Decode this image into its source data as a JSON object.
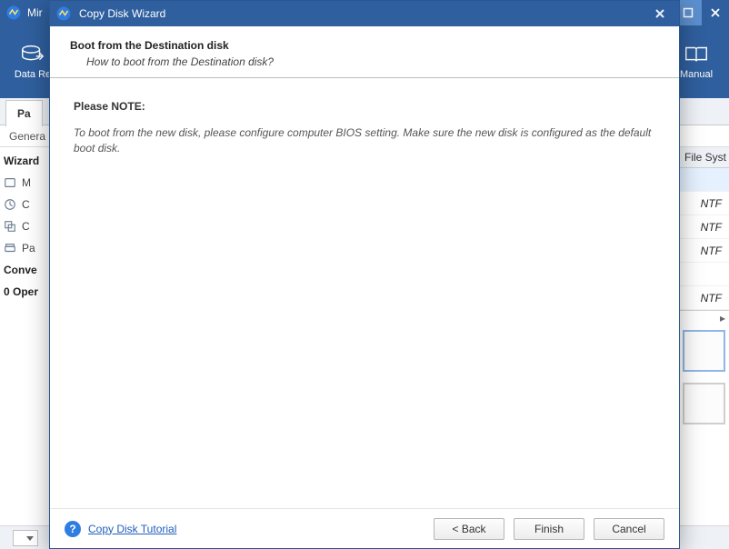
{
  "bg": {
    "title_fragment": "Mir",
    "ribbon": {
      "left_label": "Data Re",
      "right_label": "Manual"
    },
    "tab_label": "Pa",
    "subtab_label": "Genera",
    "sidebar": {
      "group1_title": "Wizard",
      "items": [
        "M",
        "C",
        "C",
        "Pa"
      ],
      "group2_title": "Conve",
      "ops_label": "0 Oper"
    },
    "rightcol": {
      "header": "File Syst",
      "rows": [
        "",
        "NTF",
        "NTF",
        "NTF",
        "",
        "NTF"
      ]
    }
  },
  "wizard": {
    "title": "Copy Disk Wizard",
    "header_title": "Boot from the Destination disk",
    "header_sub": "How to boot from the Destination disk?",
    "note_title": "Please NOTE:",
    "note_text": "To boot from the new disk, please configure computer BIOS setting. Make sure the new disk is configured as the default boot disk.",
    "help_link": "Copy Disk Tutorial",
    "btn_back": "< Back",
    "btn_finish": "Finish",
    "btn_cancel": "Cancel"
  }
}
